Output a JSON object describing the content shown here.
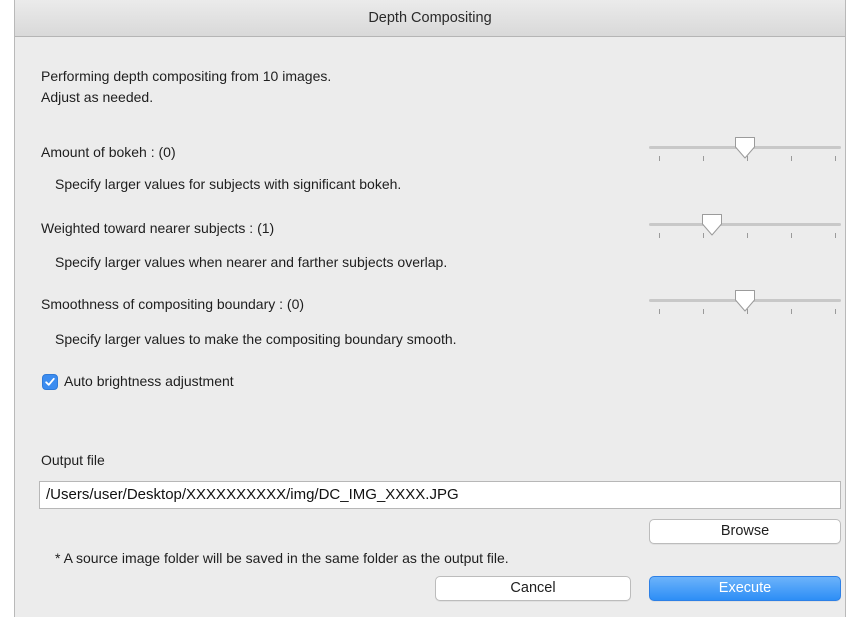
{
  "window": {
    "title": "Depth Compositing"
  },
  "intro": {
    "line1": "Performing depth compositing from 10 images.",
    "line2": "Adjust as needed."
  },
  "settings": [
    {
      "label": "Amount of bokeh : (0)",
      "hint": "Specify larger values for subjects with significant bokeh.",
      "slider_level": 0.5
    },
    {
      "label": "Weighted toward nearer subjects : (1)",
      "hint": "Specify larger values when nearer and farther subjects overlap.",
      "slider_level": 0.33
    },
    {
      "label": "Smoothness of compositing boundary : (0)",
      "hint": "Specify larger values to make the compositing boundary smooth.",
      "slider_level": 0.5
    }
  ],
  "auto_brightness": {
    "label": "Auto brightness adjustment",
    "checked": true
  },
  "output": {
    "label": "Output file",
    "path": "/Users/user/Desktop/XXXXXXXXXX/img/DC_IMG_XXXX.JPG",
    "browse_label": "Browse",
    "note": "* A source image folder will be saved in the same folder as the output file."
  },
  "actions": {
    "cancel_label": "Cancel",
    "execute_label": "Execute"
  },
  "colors": {
    "accent": "#3b8cf0",
    "window_bg": "#ececec"
  }
}
